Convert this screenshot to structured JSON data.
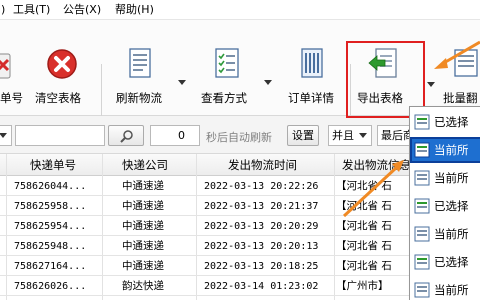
{
  "menu": [
    {
      "label": ")"
    },
    {
      "label": "工具(T)"
    },
    {
      "label": "公告(X)"
    },
    {
      "label": "帮助(H)"
    }
  ],
  "toolbar": {
    "partial_label": "单号",
    "clear_label": "清空表格",
    "refresh_label": "刷新物流",
    "view_label": "查看方式",
    "detail_label": "订单详情",
    "export_label": "导出表格",
    "batch_label": "批量翻"
  },
  "filter": {
    "combo_left_value": "",
    "search_value": "",
    "interval_value": "0",
    "interval_suffix": "秒后自动刷新",
    "settings_label": "设置",
    "and_combo": "并且",
    "last_combo": "最后商"
  },
  "table": {
    "headers": [
      "快递单号",
      "快递公司",
      "发出物流时间",
      "发出物流信息"
    ],
    "rows": [
      [
        "758626044...",
        "中通速递",
        "2022-03-13 20:22:26",
        "【河北省 石"
      ],
      [
        "758625958...",
        "中通速递",
        "2022-03-13 20:21:37",
        "【河北省 石"
      ],
      [
        "758625954...",
        "中通速递",
        "2022-03-13 20:20:29",
        "【河北省 石"
      ],
      [
        "758625948...",
        "中通速递",
        "2022-03-13 20:20:13",
        "【河北省 石"
      ],
      [
        "758627164...",
        "中通速递",
        "2022-03-13 20:18:25",
        "【河北省 石"
      ],
      [
        "758626026...",
        "韵达快递",
        "2022-03-14 01:23:02",
        "【广州市】"
      ]
    ]
  },
  "dropdown": {
    "items": [
      {
        "label": "已选择",
        "icon": "selected-icon"
      },
      {
        "label": "当前所",
        "icon": "current-page-icon",
        "active": true
      },
      {
        "label": "当前所",
        "icon": "current-page-icon"
      },
      {
        "label": "已选择",
        "icon": "selected-icon"
      },
      {
        "label": "当前所",
        "icon": "current-page-icon"
      },
      {
        "label": "已选择",
        "icon": "selected-icon"
      },
      {
        "label": "当前所",
        "icon": "current-page-icon"
      }
    ]
  },
  "colors": {
    "accent": "#1e6fd0",
    "highlight_frame": "#e02020",
    "annotation_arrow": "#f08a24"
  }
}
